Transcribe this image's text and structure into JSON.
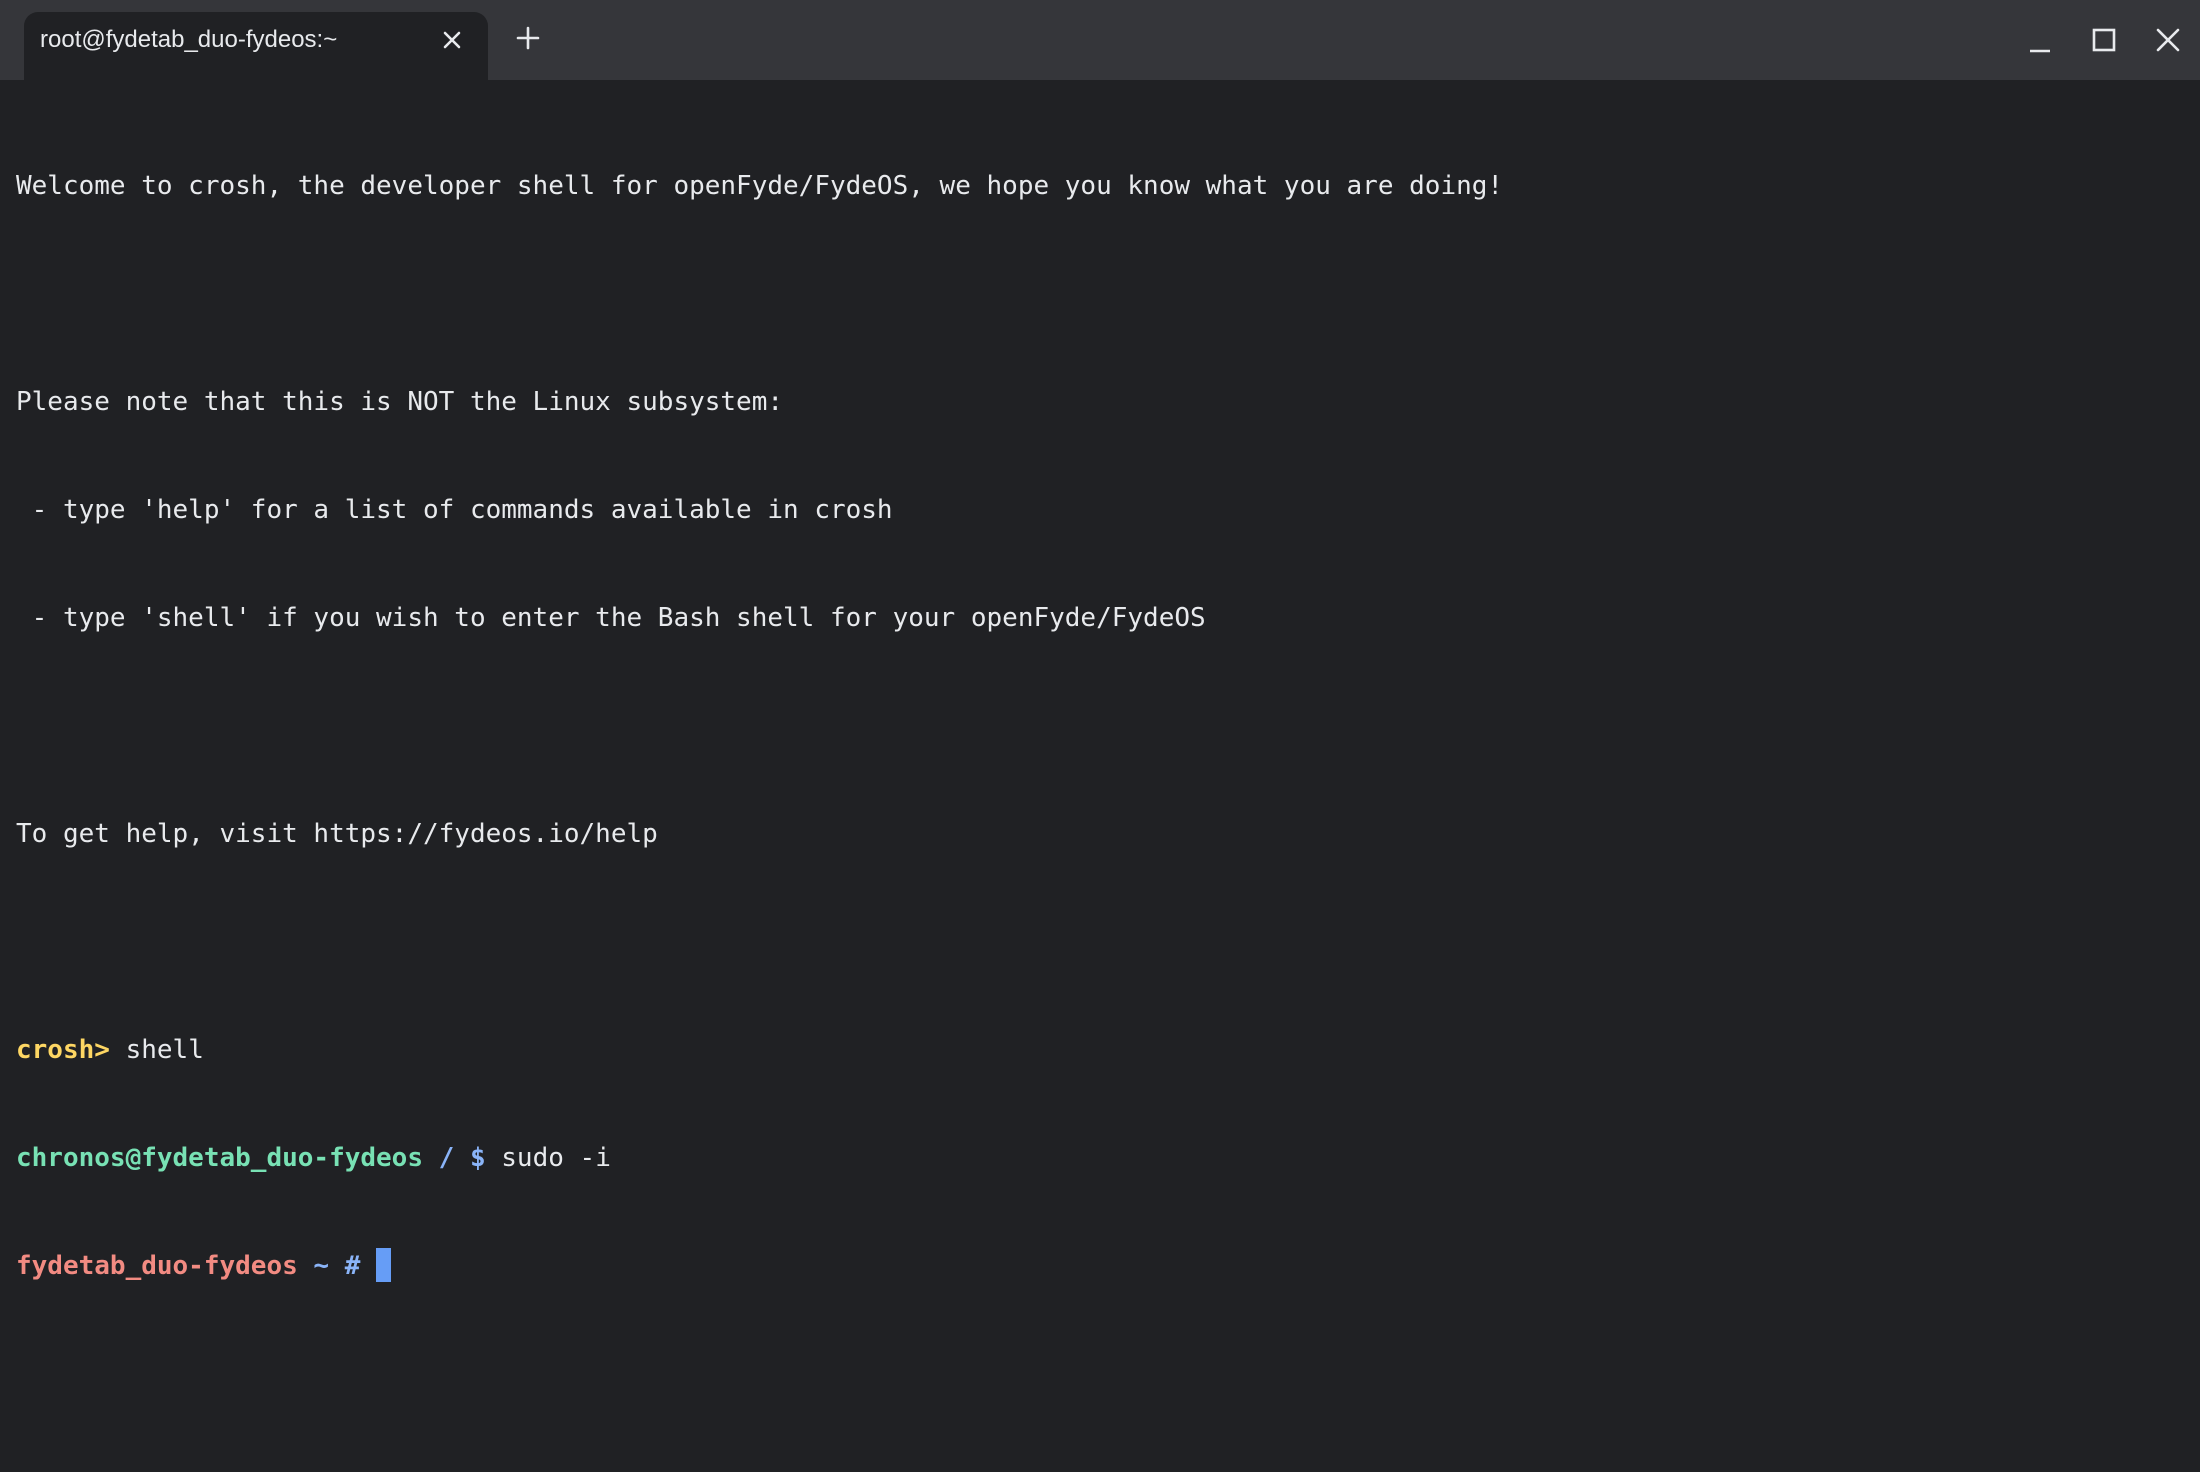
{
  "tab": {
    "title": "root@fydetab_duo-fydeos:~",
    "close_icon": "close-icon"
  },
  "new_tab_icon": "plus-icon",
  "window_controls": {
    "minimize_icon": "minimize-icon",
    "maximize_icon": "maximize-icon",
    "close_icon": "close-icon"
  },
  "terminal": {
    "welcome": "Welcome to crosh, the developer shell for openFyde/FydeOS, we hope you know what you are doing!",
    "note_header": "Please note that this is NOT the Linux subsystem:",
    "note_help": " - type 'help' for a list of commands available in crosh",
    "note_shell": " - type 'shell' if you wish to enter the Bash shell for your openFyde/FydeOS",
    "help_line": "To get help, visit https://fydeos.io/help",
    "crosh_prompt": "crosh>",
    "crosh_command": " shell",
    "user_prompt": "chronos@fydetab_duo-fydeos",
    "user_path_symbol": " / $",
    "user_command": " sudo -i",
    "root_prompt": "fydetab_duo-fydeos",
    "root_path_symbol": " ~ #",
    "root_command": " "
  },
  "colors": {
    "background": "#202124",
    "titlebar": "#35363a",
    "text": "#e8eaed",
    "crosh_prompt": "#fdd663",
    "user_prompt": "#78e1b4",
    "root_prompt": "#f28b82",
    "prompt_symbol": "#8ab4f8",
    "cursor": "#669df6"
  }
}
